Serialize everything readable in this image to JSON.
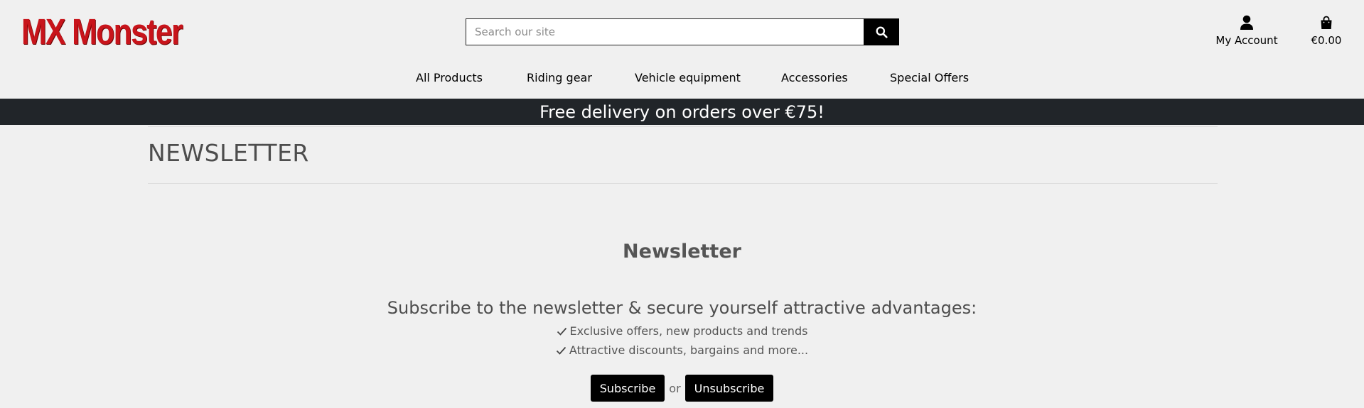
{
  "brand": {
    "logo_text": "MX Monster",
    "color": "#c8141b"
  },
  "search": {
    "placeholder": "Search our site",
    "value": "",
    "button_icon": "search-icon"
  },
  "header": {
    "account_label": "My Account",
    "account_icon": "user-icon",
    "cart_total": "€0.00",
    "cart_icon": "shopping-bag-icon"
  },
  "nav": {
    "items": [
      {
        "label": "All Products"
      },
      {
        "label": "Riding gear"
      },
      {
        "label": "Vehicle equipment"
      },
      {
        "label": "Accessories"
      },
      {
        "label": "Special Offers"
      }
    ]
  },
  "banner": {
    "text": "Free delivery on orders over €75!",
    "background": "#212529"
  },
  "page": {
    "title": "NEWSLETTER"
  },
  "newsletter": {
    "heading": "Newsletter",
    "subtitle": "Subscribe to the newsletter & secure yourself attractive advantages:",
    "benefits": [
      "Exclusive offers, new products and trends",
      "Attractive discounts, bargains and more..."
    ],
    "subscribe_label": "Subscribe",
    "or_text": "or",
    "unsubscribe_label": "Unsubscribe"
  }
}
